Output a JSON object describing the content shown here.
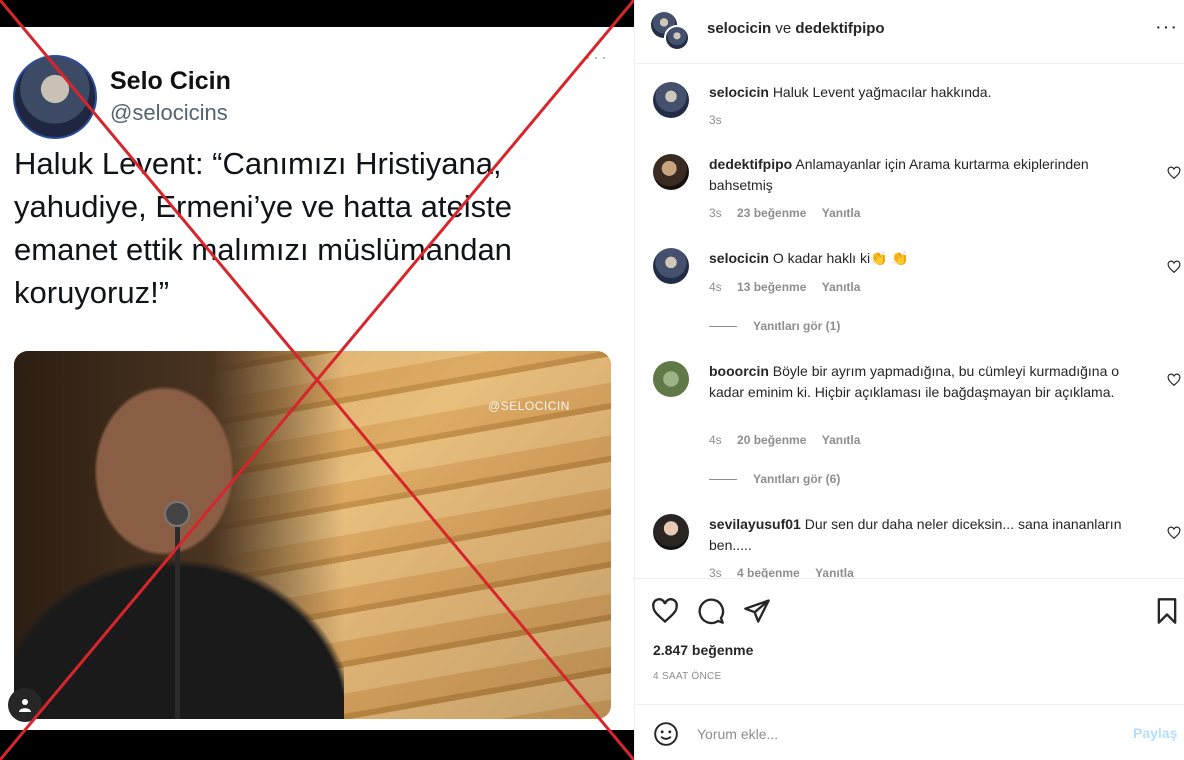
{
  "tweet": {
    "name": "Selo Cicin",
    "handle": "@selocicins",
    "more": "···",
    "text": "Haluk Levent: “Canımızı Hristiyana, yahudiye, Ermeni’ye ve hatta ateiste emanet ettik malımızı müslümandan koruyoruz!”",
    "watermark": "@SELOCICIN"
  },
  "header": {
    "user1": "selocicin",
    "connector": "ve",
    "user2": "dedektifpipo",
    "more": "···"
  },
  "comments": [
    {
      "user": "selocicin",
      "text": "Haluk Levent yağmacılar hakkında.",
      "time": "3s",
      "likes": "",
      "reply": ""
    },
    {
      "user": "dedektifpipo",
      "text": "Anlamayanlar için Arama kurtarma ekiplerinden bahsetmiş",
      "time": "3s",
      "likes": "23 beğenme",
      "reply": "Yanıtla"
    },
    {
      "user": "selocicin",
      "text": "O kadar haklı ki👏 👏",
      "time": "4s",
      "likes": "13 beğenme",
      "reply": "Yanıtla"
    },
    {
      "user": "booorcin",
      "text": "Böyle bir ayrım yapmadığına, bu cümleyi kurmadığına o kadar eminim ki. Hiçbir açıklaması ile bağdaşmayan bir açıklama.",
      "time": "4s",
      "likes": "20 beğenme",
      "reply": "Yanıtla"
    },
    {
      "user": "sevilayusuf01",
      "text": "Dur sen dur daha neler diceksin... sana inananların ben.....",
      "time": "3s",
      "likes": "4 beğenme",
      "reply": "Yanıtla"
    }
  ],
  "view_replies": [
    "Yanıtları gör (1)",
    "Yanıtları gör (6)"
  ],
  "post": {
    "likes": "2.847 beğenme",
    "ago": "4 SAAT ÖNCE"
  },
  "add_comment": {
    "placeholder": "Yorum ekle...",
    "share": "Paylaş"
  },
  "colors": {
    "cross": "#d7252b",
    "share_disabled": "#b2dffc",
    "muted": "#8e8e8e"
  },
  "icons": [
    "heart-icon",
    "comment-icon",
    "share-icon",
    "bookmark-icon",
    "emoji-icon",
    "more-icon"
  ]
}
